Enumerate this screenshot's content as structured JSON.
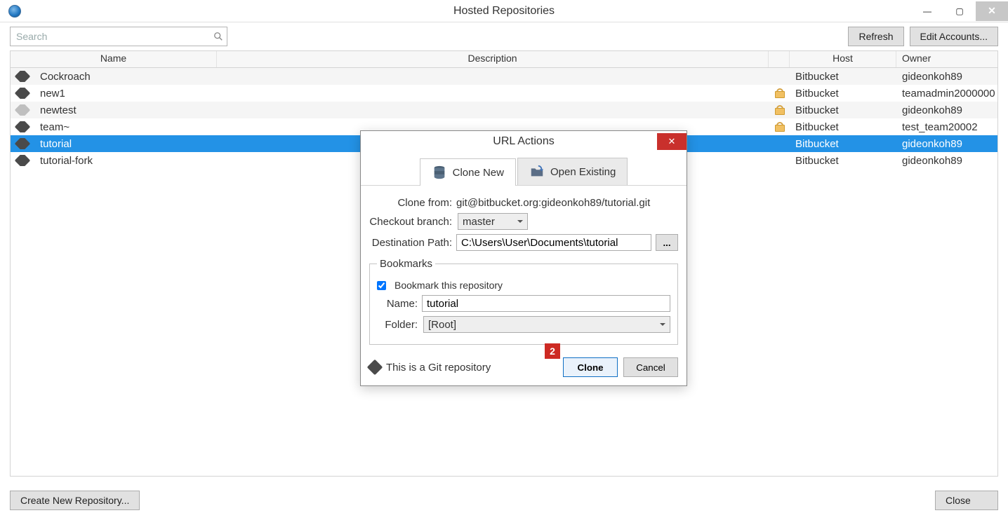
{
  "window": {
    "title": "Hosted Repositories"
  },
  "toolbar": {
    "search_placeholder": "Search",
    "refresh_label": "Refresh",
    "edit_accounts_label": "Edit Accounts..."
  },
  "table": {
    "headers": {
      "name": "Name",
      "description": "Description",
      "host": "Host",
      "owner": "Owner"
    },
    "rows": [
      {
        "name": "Cockroach",
        "host": "Bitbucket",
        "owner": "gideonkoh89",
        "locked": false,
        "icon": "normal",
        "selected": false
      },
      {
        "name": "new1",
        "host": "Bitbucket",
        "owner": "teamadmin2000000",
        "locked": true,
        "icon": "normal",
        "selected": false
      },
      {
        "name": "newtest",
        "host": "Bitbucket",
        "owner": "gideonkoh89",
        "locked": true,
        "icon": "grey",
        "selected": false
      },
      {
        "name": "team~",
        "host": "Bitbucket",
        "owner": "test_team20002",
        "locked": true,
        "icon": "normal",
        "selected": false
      },
      {
        "name": "tutorial",
        "host": "Bitbucket",
        "owner": "gideonkoh89",
        "locked": false,
        "icon": "normal",
        "selected": true
      },
      {
        "name": "tutorial-fork",
        "host": "Bitbucket",
        "owner": "gideonkoh89",
        "locked": false,
        "icon": "normal",
        "selected": false
      }
    ]
  },
  "bottom": {
    "create_label": "Create New Repository...",
    "close_label": "Close"
  },
  "dialog": {
    "title": "URL Actions",
    "tab_clone": "Clone New",
    "tab_open": "Open Existing",
    "clone_from_label": "Clone from:",
    "clone_from_value": "git@bitbucket.org:gideonkoh89/tutorial.git",
    "checkout_branch_label": "Checkout branch:",
    "checkout_branch_value": "master",
    "dest_path_label": "Destination Path:",
    "dest_path_value": "C:\\Users\\User\\Documents\\tutorial",
    "browse_label": "...",
    "bookmarks_legend": "Bookmarks",
    "bookmark_checkbox_label": "Bookmark this repository",
    "bookmark_name_label": "Name:",
    "bookmark_name_value": "tutorial",
    "bookmark_folder_label": "Folder:",
    "bookmark_folder_value": "[Root]",
    "status_text": "This is a Git repository",
    "clone_btn": "Clone",
    "cancel_btn": "Cancel",
    "callout_number": "2"
  }
}
